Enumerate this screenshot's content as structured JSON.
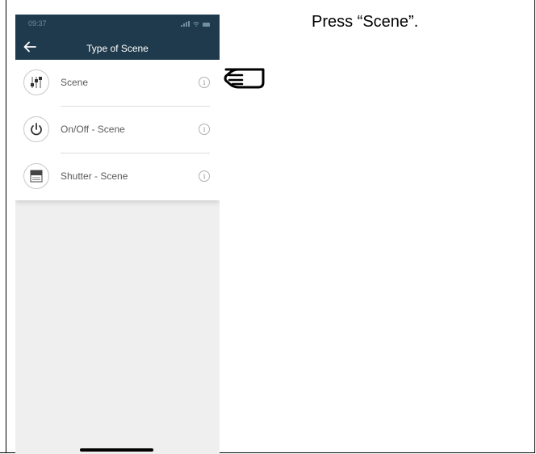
{
  "status_bar": {
    "time": "09:37"
  },
  "nav": {
    "title": "Type of Scene",
    "back_icon": "arrow-left-icon"
  },
  "list": {
    "items": [
      {
        "label": "Scene",
        "icon": "sliders-icon"
      },
      {
        "label": "On/Off - Scene",
        "icon": "power-icon"
      },
      {
        "label": "Shutter - Scene",
        "icon": "shutter-icon"
      }
    ],
    "info_symbol": "i"
  },
  "instruction": {
    "text": "Press “Scene”."
  },
  "colors": {
    "nav_background": "#1e3a4c",
    "nav_text": "#ffffff",
    "screen_background": "#efefef",
    "list_background": "#ffffff"
  }
}
